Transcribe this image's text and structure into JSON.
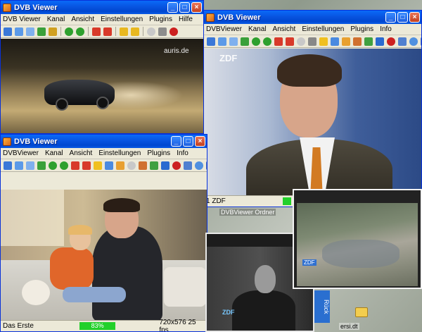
{
  "window1": {
    "title": "DVB Viewer",
    "menu": [
      "DVB Viewer",
      "Kanal",
      "Ansicht",
      "Einstellungen",
      "Plugins",
      "Hilfe"
    ],
    "watermark": "auris.de"
  },
  "window2": {
    "title": "DVB Viewer",
    "menu": [
      "DVBViewer",
      "Kanal",
      "Ansicht",
      "Einstellungen",
      "Plugins",
      "Info"
    ],
    "channel_logo": "ZDF",
    "status_channel": "1 ZDF"
  },
  "window3": {
    "title": "DVB Viewer",
    "menu": [
      "DVBViewer",
      "Kanal",
      "Ansicht",
      "Einstellungen",
      "Plugins",
      "Info"
    ],
    "status_channel": "Das Erste",
    "status_level": "83%",
    "status_resolution": "720x576 25 fps"
  },
  "window4": {
    "logo": "ZDF"
  },
  "window5": {
    "logo": "ZDF",
    "side_label": "Rück"
  },
  "desktop": {
    "folder_label": "DVBViewer Ordner",
    "file_label": "ersi.dt"
  },
  "colors": {
    "titlebar": "#0a5ae6",
    "status_green": "#22d02a"
  },
  "window_buttons": {
    "minimize": "_",
    "maximize": "□",
    "close": "×"
  }
}
